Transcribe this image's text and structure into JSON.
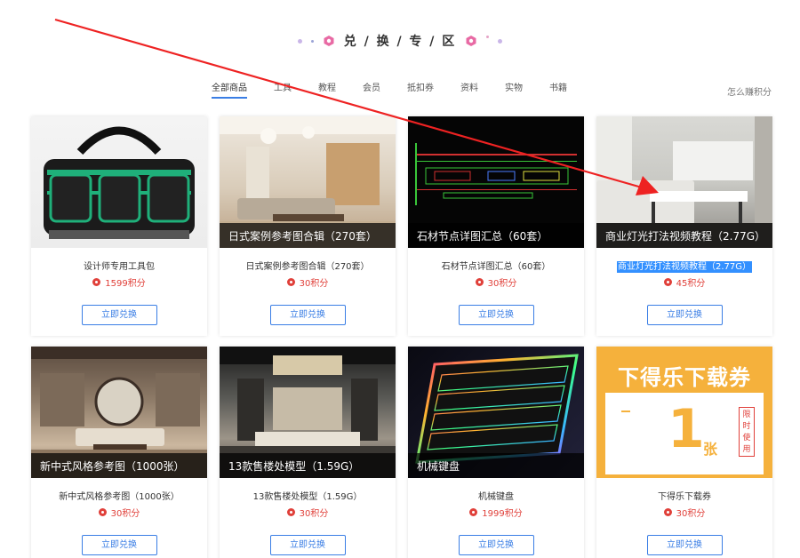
{
  "header": {
    "title": "兑 / 换 / 专 / 区",
    "earn_link": "怎么赚积分"
  },
  "tabs": [
    "全部商品",
    "工具",
    "教程",
    "会员",
    "抵扣券",
    "资料",
    "实物",
    "书籍"
  ],
  "action_label": "立即兑换",
  "voucher": {
    "title": "下得乐下载券",
    "number": "1",
    "unit": "张",
    "side_text": "限时使用"
  },
  "products": [
    {
      "caption": "",
      "name": "设计师专用工具包",
      "price": "1599积分"
    },
    {
      "caption": "日式案例参考图合辑（270套）",
      "name": "日式案例参考图合辑（270套）",
      "price": "30积分"
    },
    {
      "caption": "石材节点详图汇总（60套）",
      "name": "石材节点详图汇总（60套）",
      "price": "30积分"
    },
    {
      "caption": "商业灯光打法视频教程（2.77G）",
      "name": "商业灯光打法视频教程（2.77G）",
      "price": "45积分",
      "selected": true
    },
    {
      "caption": "新中式风格参考图（1000张）",
      "name": "新中式风格参考图（1000张）",
      "price": "30积分"
    },
    {
      "caption": "13款售楼处模型（1.59G）",
      "name": "13款售楼处模型（1.59G）",
      "price": "30积分"
    },
    {
      "caption": "机械键盘",
      "name": "机械键盘",
      "price": "1999积分"
    },
    {
      "caption": "",
      "name": "下得乐下载券",
      "price": "30积分"
    }
  ],
  "colors": {
    "accent": "#3a7ee5",
    "price": "#e0403a",
    "annotation_arrow": "#ee2222",
    "voucher": "#f5b13c"
  }
}
